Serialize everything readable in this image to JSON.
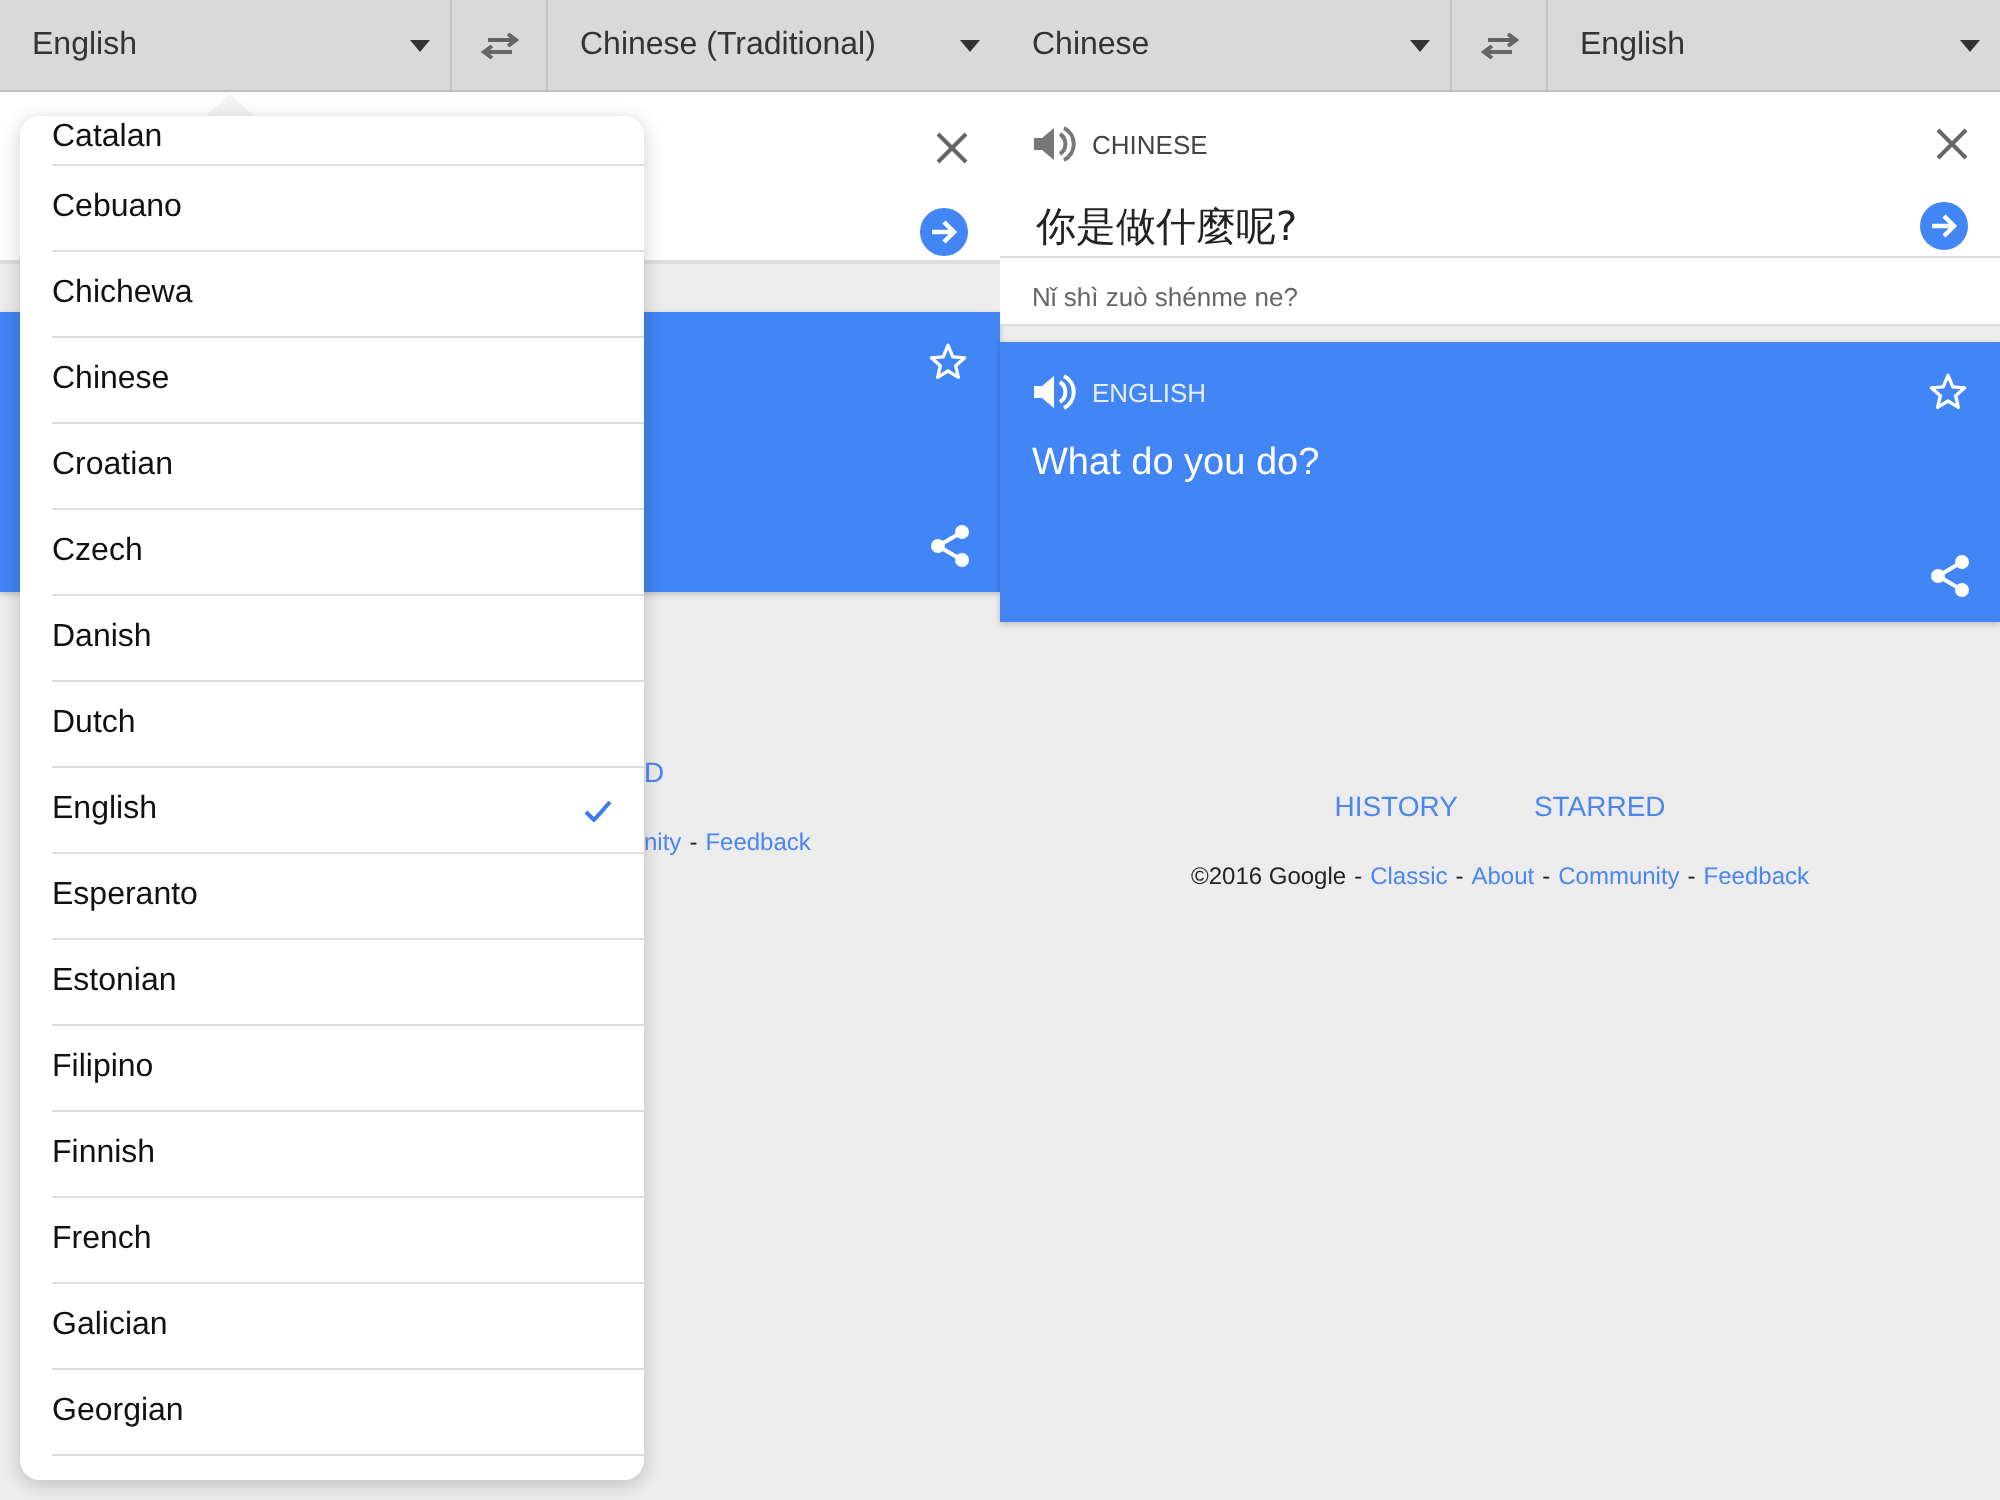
{
  "panes": [
    {
      "source_lang": "English",
      "target_lang": "Chinese (Traditional)",
      "footer_links": [
        {
          "label": "D"
        }
      ],
      "footer_parts": [
        {
          "kind": "link",
          "text": "nity"
        },
        {
          "kind": "sep",
          "text": "-"
        },
        {
          "kind": "link",
          "text": "Feedback"
        }
      ]
    },
    {
      "source_lang": "Chinese",
      "target_lang": "English",
      "source_label": "CHINESE",
      "source_text": "你是做什麼呢?",
      "romanization": "Nǐ shì zuò shénme ne?",
      "target_label": "ENGLISH",
      "translation": "What do you do?",
      "footer_links": [
        {
          "label": "HISTORY"
        },
        {
          "label": "STARRED"
        }
      ],
      "footer_parts": [
        {
          "kind": "text",
          "text": "©2016 Google"
        },
        {
          "kind": "sep",
          "text": "-"
        },
        {
          "kind": "link",
          "text": "Classic"
        },
        {
          "kind": "sep",
          "text": "-"
        },
        {
          "kind": "link",
          "text": "About"
        },
        {
          "kind": "sep",
          "text": "-"
        },
        {
          "kind": "link",
          "text": "Community"
        },
        {
          "kind": "sep",
          "text": "-"
        },
        {
          "kind": "link",
          "text": "Feedback"
        }
      ]
    }
  ],
  "language_menu": {
    "items": [
      {
        "label": "Catalan",
        "selected": false
      },
      {
        "label": "Cebuano",
        "selected": false
      },
      {
        "label": "Chichewa",
        "selected": false
      },
      {
        "label": "Chinese",
        "selected": false
      },
      {
        "label": "Croatian",
        "selected": false
      },
      {
        "label": "Czech",
        "selected": false
      },
      {
        "label": "Danish",
        "selected": false
      },
      {
        "label": "Dutch",
        "selected": false
      },
      {
        "label": "English",
        "selected": true
      },
      {
        "label": "Esperanto",
        "selected": false
      },
      {
        "label": "Estonian",
        "selected": false
      },
      {
        "label": "Filipino",
        "selected": false
      },
      {
        "label": "Finnish",
        "selected": false
      },
      {
        "label": "French",
        "selected": false
      },
      {
        "label": "Galician",
        "selected": false
      },
      {
        "label": "Georgian",
        "selected": false
      }
    ]
  }
}
